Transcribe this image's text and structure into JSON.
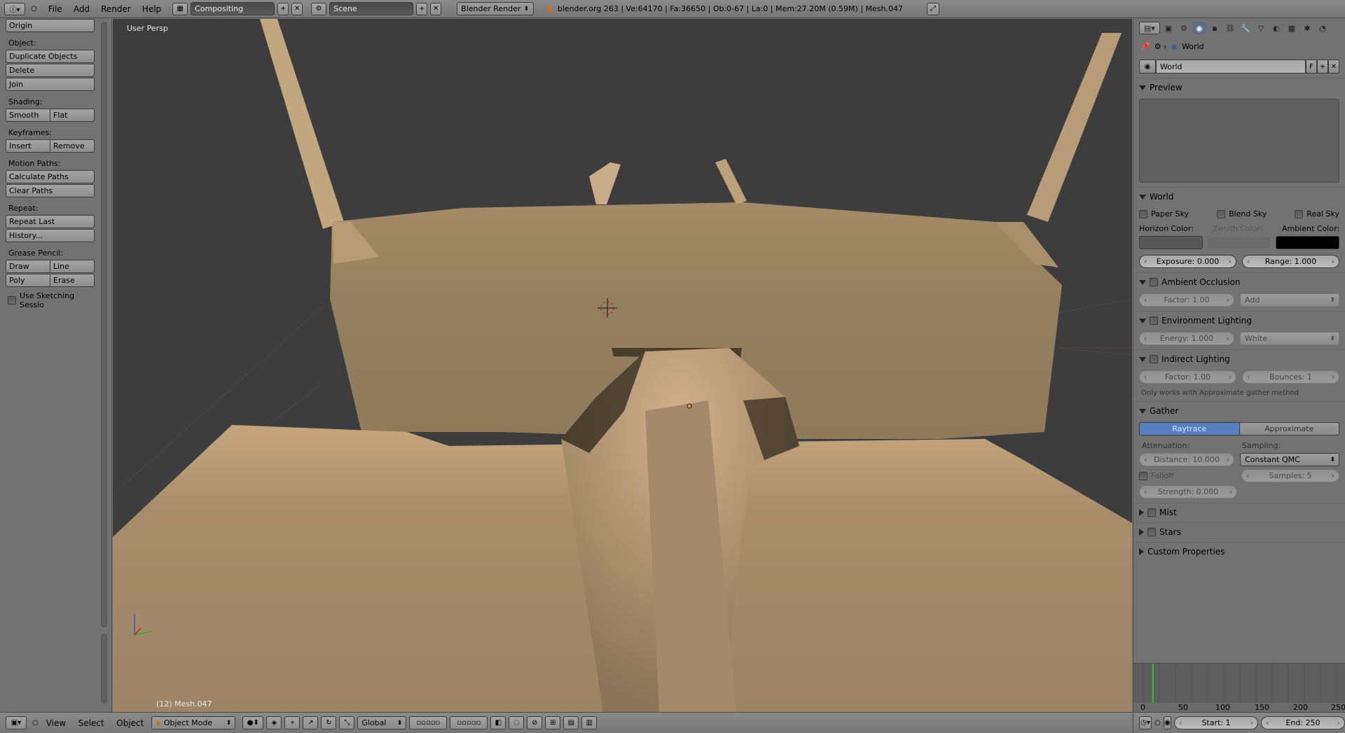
{
  "topbar": {
    "menus": [
      "File",
      "Add",
      "Render",
      "Help"
    ],
    "layout_name": "Compositing",
    "scene_name": "Scene",
    "render_engine": "Blender Render",
    "stats": "blender.org 263 | Ve:64170 | Fa:36650 | Ob:0-67 | La:0 | Mem:27.20M (0.59M) | Mesh.047"
  },
  "toolshelf": {
    "origin": "Origin",
    "object_label": "Object:",
    "duplicate": "Duplicate Objects",
    "delete": "Delete",
    "join": "Join",
    "shading_label": "Shading:",
    "smooth": "Smooth",
    "flat": "Flat",
    "keyframes_label": "Keyframes:",
    "insert": "Insert",
    "remove": "Remove",
    "motion_label": "Motion Paths:",
    "calc_paths": "Calculate Paths",
    "clear_paths": "Clear Paths",
    "repeat_label": "Repeat:",
    "repeat_last": "Repeat Last",
    "history": "History...",
    "grease_label": "Grease Pencil:",
    "draw": "Draw",
    "line": "Line",
    "poly": "Poly",
    "erase": "Erase",
    "sketching": "Use Sketching Sessio"
  },
  "viewport": {
    "view_label": "User Persp",
    "object_info": "(12) Mesh.047"
  },
  "bottombar": {
    "menus": [
      "View",
      "Select",
      "Object"
    ],
    "mode": "Object Mode",
    "orientation": "Global"
  },
  "props": {
    "breadcrumb": "World",
    "world_name": "World",
    "fake_user": "F",
    "preview": "Preview",
    "world_section": "World",
    "paper_sky": "Paper Sky",
    "blend_sky": "Blend Sky",
    "real_sky": "Real Sky",
    "horizon_color": "Horizon Color:",
    "zenith_color": "Zenith Color:",
    "ambient_color": "Ambient Color:",
    "exposure": "Exposure: 0.000",
    "range": "Range: 1.000",
    "ambient_occlusion": "Ambient Occlusion",
    "ao_factor": "Factor: 1.00",
    "ao_blend": "Add",
    "env_lighting": "Environment Lighting",
    "env_energy": "Energy: 1.000",
    "env_color": "White",
    "indirect_lighting": "Indirect Lighting",
    "ind_factor": "Factor: 1.00",
    "ind_bounces": "Bounces: 1",
    "ind_note": "Only works with Approximate gather method",
    "gather": "Gather",
    "raytrace": "Raytrace",
    "approximate": "Approximate",
    "attenuation": "Attenuation:",
    "sampling": "Sampling:",
    "distance": "Distance: 10.000",
    "sampling_method": "Constant QMC",
    "falloff": "Falloff",
    "samples": "Samples: 5",
    "strength": "Strength: 0.000",
    "mist": "Mist",
    "stars": "Stars",
    "custom_props": "Custom Properties",
    "colors": {
      "horizon": "#575757",
      "zenith": "#6a6a6a",
      "ambient": "#000000",
      "active_tab": "#5a6e8a",
      "raytrace_on": "#5680c2"
    }
  },
  "timeline": {
    "ticks": [
      "0",
      "50",
      "100",
      "150",
      "200",
      "250"
    ],
    "start": "Start: 1",
    "end": "End: 250",
    "current_frame_fraction": 0.05
  }
}
